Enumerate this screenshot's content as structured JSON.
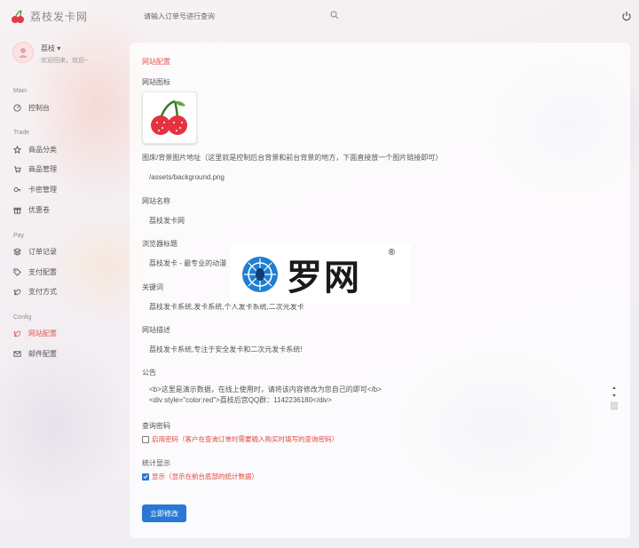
{
  "brand": {
    "name": "荔枝发卡网",
    "logo_icon": "cherry-icon"
  },
  "search": {
    "placeholder": "请输入订单号进行查询"
  },
  "user": {
    "name": "荔枝",
    "caret": "▾",
    "greeting": "欢迎回来，欢迎~"
  },
  "sidebar": {
    "sections": [
      {
        "label": "Main"
      },
      {
        "label": "Trade"
      },
      {
        "label": "Pay"
      },
      {
        "label": "Config"
      }
    ],
    "items": [
      {
        "label": "控制台",
        "icon": "dashboard-icon"
      },
      {
        "label": "商品分类",
        "icon": "star-icon"
      },
      {
        "label": "商品管理",
        "icon": "cart-icon"
      },
      {
        "label": "卡密管理",
        "icon": "key-icon"
      },
      {
        "label": "优惠卷",
        "icon": "gift-icon"
      },
      {
        "label": "订单记录",
        "icon": "layers-icon"
      },
      {
        "label": "支付配置",
        "icon": "tag-icon"
      },
      {
        "label": "支付方式",
        "icon": "twitter-icon"
      },
      {
        "label": "网站配置",
        "icon": "twitter-icon",
        "active": true
      },
      {
        "label": "邮件配置",
        "icon": "mail-icon"
      }
    ]
  },
  "config": {
    "title": "网站配置",
    "site_icon_label": "网站图标",
    "background_label": "图床/背景图片地址（这里就是控制后台背景和前台背景的地方，下面直接放一个图片链接即可）",
    "background_value": "/assets/background.png",
    "site_name_label": "网站名称",
    "site_name_value": "荔枝发卡网",
    "browser_title_label": "浏览器标题",
    "browser_title_value": "荔枝发卡 - 最专业的动漫",
    "keywords_label": "关键词",
    "keywords_value": "荔枝发卡系统,发卡系统,个人发卡系统,二次元发卡",
    "description_label": "网站描述",
    "description_value": "荔枝发卡系统,专注于安全发卡和二次元发卡系统!",
    "notice_label": "公告",
    "notice_line1": "<b>这里是演示数据，在线上使用时，请将该内容修改为您自己的即可</b>",
    "notice_line2": "<div style=\"color:red\">荔枝后宫QQ群：1142236180</div>",
    "query_pwd_label": "查询密码",
    "query_pwd_checkbox": "启用密码（客户在查询订单时需要输入购买时填写的查询密码）",
    "query_pwd_checked": false,
    "stats_label": "统计显示",
    "stats_checkbox": "显示（显示在前台底部的统计数据）",
    "stats_checked": true,
    "submit_label": "立即修改"
  },
  "watermark": {
    "text": "罗网",
    "reg": "®"
  },
  "colors": {
    "accent": "#e0574f",
    "primary": "#2a78d6",
    "text": "#555555"
  }
}
